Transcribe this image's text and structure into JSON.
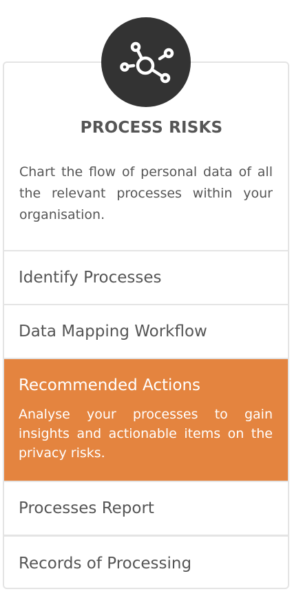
{
  "card": {
    "icon": "process-network-icon",
    "title": "PROCESS RISKS",
    "description": "Chart the flow of personal data of all the relevant processes within your organisation."
  },
  "menu": [
    {
      "label": "Identify Processes"
    },
    {
      "label": "Data Mapping Workflow"
    },
    {
      "label": "Recommended Actions",
      "active": true,
      "description": "Analyse your processes to gain insights and actionable items on the privacy risks."
    },
    {
      "label": "Processes Report"
    },
    {
      "label": "Records of Processing"
    }
  ],
  "colors": {
    "accent": "#e4843f",
    "icon_bg": "#333333",
    "text": "#555555",
    "border": "#e4e4e4"
  }
}
